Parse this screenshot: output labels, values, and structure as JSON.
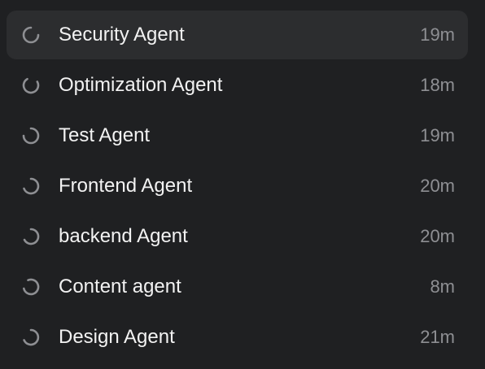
{
  "agents": [
    {
      "name": "Security Agent",
      "time": "19m",
      "selected": true
    },
    {
      "name": "Optimization Agent",
      "time": "18m",
      "selected": false
    },
    {
      "name": "Test Agent",
      "time": "19m",
      "selected": false
    },
    {
      "name": "Frontend Agent",
      "time": "20m",
      "selected": false
    },
    {
      "name": "backend Agent",
      "time": "20m",
      "selected": false
    },
    {
      "name": "Content agent",
      "time": "8m",
      "selected": false
    },
    {
      "name": "Design Agent",
      "time": "21m",
      "selected": false
    }
  ],
  "colors": {
    "background": "#1f2022",
    "selected_row": "#2c2d2f",
    "name_text": "#f2f2f2",
    "time_text": "#8e8f93",
    "spinner": "#8e8f93"
  },
  "icons": {
    "row_status": "spinner-icon"
  }
}
